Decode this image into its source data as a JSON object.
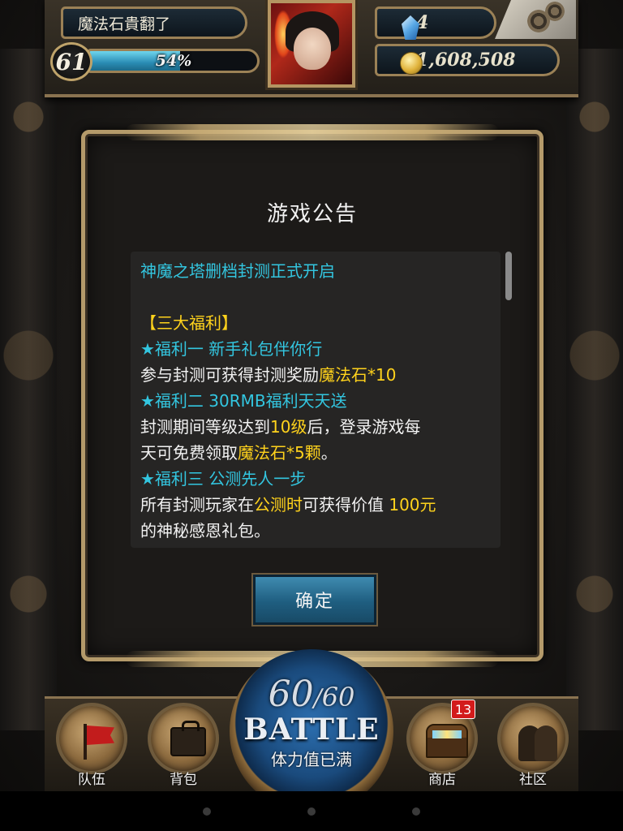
{
  "header": {
    "player_name": "魔法石貴翻了",
    "level": "61",
    "exp_percent_label": "54%",
    "exp_fraction": 0.54,
    "gems": "4",
    "coins": "1,608,508",
    "icons": {
      "gem": "blue-crystal-icon",
      "coin": "gold-coin-icon",
      "settings": "gear-icon"
    }
  },
  "dialog": {
    "title": "游戏公告",
    "lines": [
      {
        "segments": [
          {
            "text": "神魔之塔删档封测正式开启",
            "color": "cyan"
          }
        ]
      },
      {
        "segments": []
      },
      {
        "segments": [
          {
            "text": "【三大福利】",
            "color": "yellow"
          }
        ]
      },
      {
        "segments": [
          {
            "text": "★福利一 新手礼包伴你行",
            "color": "cyan"
          }
        ]
      },
      {
        "segments": [
          {
            "text": "参与封测可获得封测奖励",
            "color": "white"
          },
          {
            "text": "魔法石*10",
            "color": "yellow"
          }
        ]
      },
      {
        "segments": [
          {
            "text": "★福利二 30RMB福利天天送",
            "color": "cyan"
          }
        ]
      },
      {
        "segments": [
          {
            "text": "封测期间等级达到",
            "color": "white"
          },
          {
            "text": "10级",
            "color": "yellow"
          },
          {
            "text": "后，登录游戏每",
            "color": "white"
          }
        ]
      },
      {
        "segments": [
          {
            "text": "天可免费领取",
            "color": "white"
          },
          {
            "text": "魔法石*5颗",
            "color": "yellow"
          },
          {
            "text": "。",
            "color": "white"
          }
        ]
      },
      {
        "segments": [
          {
            "text": " ★福利三 公测先人一步",
            "color": "cyan"
          }
        ]
      },
      {
        "segments": [
          {
            "text": "所有封测玩家在",
            "color": "white"
          },
          {
            "text": "公测时",
            "color": "yellow"
          },
          {
            "text": "可获得价值 ",
            "color": "white"
          },
          {
            "text": "100元",
            "color": "yellow"
          }
        ]
      },
      {
        "segments": [
          {
            "text": "的神秘感恩礼包。",
            "color": "white"
          }
        ]
      }
    ],
    "confirm_label": "确定"
  },
  "battle": {
    "stamina_current": "60",
    "stamina_separator": "/",
    "stamina_max": "60",
    "label": "BATTLE",
    "status": "体力值已满"
  },
  "nav": {
    "team": {
      "label": "队伍",
      "icon": "red-flag-icon"
    },
    "bag": {
      "label": "背包",
      "icon": "backpack-icon"
    },
    "shop": {
      "label": "商店",
      "icon": "treasure-chest-icon",
      "badge": "13"
    },
    "community": {
      "label": "社区",
      "icon": "people-silhouette-icon"
    }
  },
  "colors": {
    "cyan": "#33c6e0",
    "yellow": "#ffd21c",
    "white": "#f2f2f2",
    "badge_red": "#d31b1b",
    "button_blue": "#1f5e80"
  }
}
